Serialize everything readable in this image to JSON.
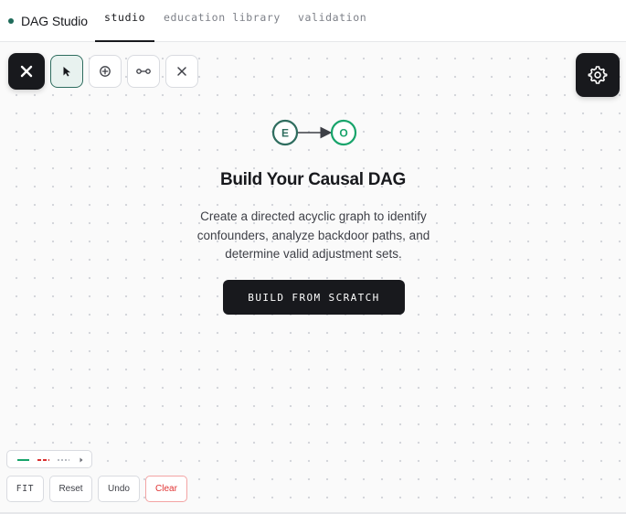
{
  "app": {
    "brand": "DAG Studio",
    "brand_color": "#1f6b5a"
  },
  "nav": {
    "tabs": [
      {
        "label": "studio",
        "active": true
      },
      {
        "label": "education library",
        "active": false
      },
      {
        "label": "validation",
        "active": false
      }
    ]
  },
  "toolbar": {
    "tools": [
      {
        "name": "close-panel",
        "icon": "close-icon",
        "style": "dark"
      },
      {
        "name": "select",
        "icon": "cursor-icon",
        "selected": true
      },
      {
        "name": "add-node",
        "icon": "plus-circle-icon"
      },
      {
        "name": "add-edge",
        "icon": "connect-icon"
      },
      {
        "name": "delete",
        "icon": "close-icon"
      }
    ],
    "settings_icon": "gear-icon"
  },
  "empty_state": {
    "diagram": {
      "nodes": [
        {
          "label": "E",
          "color": "#2f6d5f"
        },
        {
          "label": "O",
          "color": "#18a46b"
        }
      ]
    },
    "title": "Build Your Causal DAG",
    "description": "Create a directed acyclic graph to identify confounders, analyze backdoor paths, and determine valid adjustment sets.",
    "cta_label": "BUILD FROM SCRATCH"
  },
  "legend": {
    "items": [
      {
        "style": "solid",
        "color": "#18a46b"
      },
      {
        "style": "dashed",
        "color": "#d93030"
      },
      {
        "style": "dotted",
        "color": "#b8bbc2"
      }
    ],
    "expand_icon": "caret-right-icon"
  },
  "bottom_controls": {
    "fit_label": "FIT",
    "reset_label": "Reset",
    "undo_label": "Undo",
    "clear_label": "Clear"
  },
  "colors": {
    "accent_dark": "#18191d",
    "danger": "#e03232",
    "select_accent": "#2f6d5f"
  }
}
